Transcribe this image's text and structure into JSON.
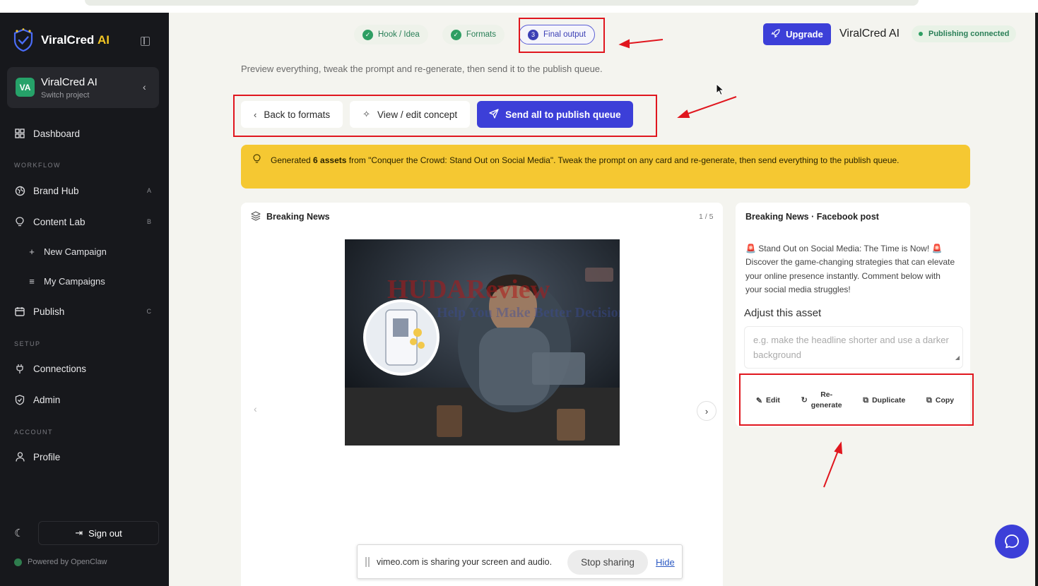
{
  "app": {
    "brand_main": "ViralCred",
    "brand_accent": "AI",
    "accent_color": "#3c3fd8",
    "brand_yellow": "#f3c623"
  },
  "project": {
    "avatar": "VA",
    "name": "ViralCred AI",
    "subtitle": "Switch project"
  },
  "sidebar": {
    "dashboard": "Dashboard",
    "workflow_label": "WORKFLOW",
    "brand_hub": "Brand Hub",
    "brand_hub_key": "A",
    "content_lab": "Content Lab",
    "content_lab_key": "B",
    "new_campaign": "New Campaign",
    "my_campaigns": "My Campaigns",
    "publish": "Publish",
    "publish_key": "C",
    "setup_label": "SETUP",
    "connections": "Connections",
    "admin": "Admin",
    "account_label": "ACCOUNT",
    "profile": "Profile",
    "sign_out": "Sign out",
    "powered_by": "Powered by OpenClaw"
  },
  "steps": [
    {
      "label": "Hook / Idea",
      "state": "done"
    },
    {
      "label": "Formats",
      "state": "done"
    },
    {
      "label": "Final output",
      "state": "active",
      "number": "3"
    }
  ],
  "header": {
    "upgrade": "Upgrade",
    "title": "ViralCred AI",
    "status": "Publishing connected"
  },
  "intro": "Preview everything, tweak the prompt and re-generate, then send it to the publish queue.",
  "buttons": {
    "back": "Back to formats",
    "view_edit": "View / edit concept",
    "send": "Send all to publish queue"
  },
  "alert": {
    "prefix": "Generated ",
    "count": "6 assets",
    "rest": " from \"Conquer the Crowd: Stand Out on Social Media\". Tweak the prompt on any card and re-generate, then send everything to the publish queue."
  },
  "preview": {
    "title": "Breaking News",
    "counter": "1 / 5",
    "watermark_main": "HUDAReview",
    "watermark_sub": "Help You Make Better Decisions"
  },
  "asset": {
    "title": "Breaking News · Facebook post",
    "post_text": "🚨 Stand Out on Social Media: The Time is Now! 🚨 Discover the game-changing strategies that can elevate your online presence instantly. Comment below with your social media struggles!",
    "adjust_label": "Adjust this asset",
    "prompt_placeholder": "e.g. make the headline shorter and use a darker background",
    "actions": {
      "edit": "Edit",
      "regenerate_1": "Re-",
      "regenerate_2": "generate",
      "duplicate": "Duplicate",
      "copy": "Copy"
    }
  },
  "share_bar": {
    "message": "vimeo.com is sharing your screen and audio.",
    "stop": "Stop sharing",
    "hide": "Hide"
  }
}
